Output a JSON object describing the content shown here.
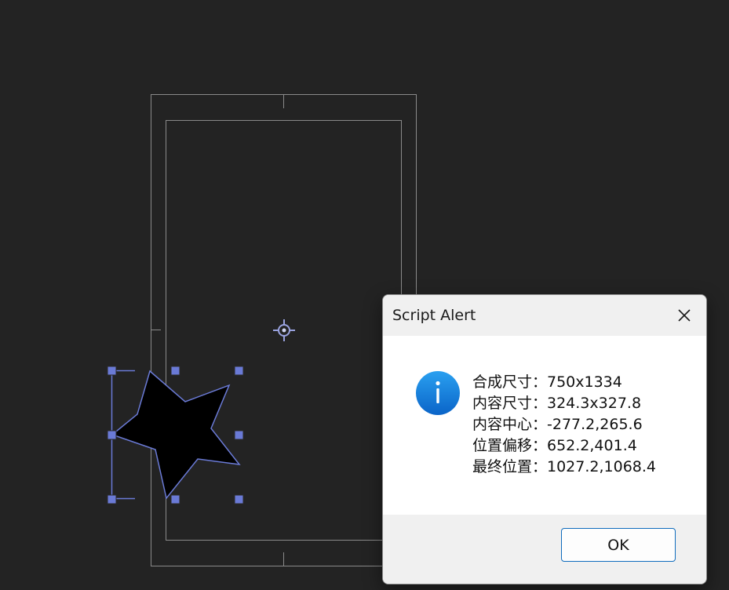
{
  "dialog": {
    "title": "Script Alert",
    "icon": "info-icon",
    "message_lines": [
      "合成尺寸：750x1334",
      "内容尺寸：324.3x327.8",
      "内容中心：-277.2,265.6",
      "位置偏移：652.2,401.4",
      "最终位置：1027.2,1068.4"
    ],
    "ok_label": "OK",
    "close_icon": "close-icon"
  },
  "canvas": {
    "background": "#232323",
    "selection_color": "#6a7ad6",
    "guide_color": "#8a8a8a",
    "star_fill": "#000000",
    "anchor_icon": "anchor-point-icon"
  }
}
